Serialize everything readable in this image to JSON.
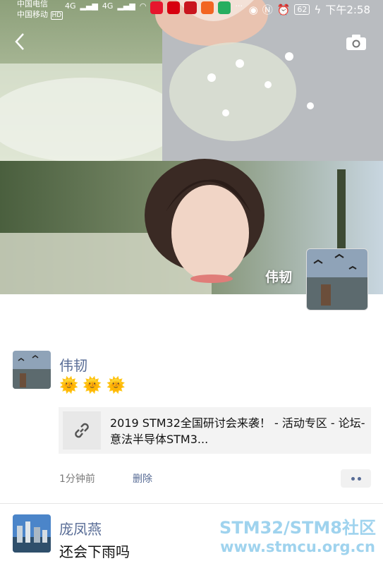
{
  "status_bar": {
    "carrier1": "中国电信",
    "carrier2": "中国移动",
    "hd_badge": "HD",
    "signal1": "4G",
    "signal2": "4G",
    "ellipsis": "···",
    "battery": "62",
    "time": "下午2:58"
  },
  "header": {
    "back_icon": "chevron-left-icon",
    "camera_icon": "camera-icon"
  },
  "profile": {
    "name": "伟韧"
  },
  "post1": {
    "author": "伟韧",
    "emoji": "🌞🌞🌞",
    "link_text": "2019 STM32全国研讨会来袭！ - 活动专区 - 论坛-意法半导体STM3...",
    "link_icon": "link-icon",
    "time": "1分钟前",
    "delete_label": "删除"
  },
  "post2": {
    "author": "庞凤燕",
    "text": "还会下雨吗"
  },
  "watermark": {
    "line1": "STM32/STM8社区",
    "line2": "www.stmcu.org.cn"
  },
  "colors": {
    "link_blue": "#576b95",
    "watermark": "#9fd3ee"
  }
}
